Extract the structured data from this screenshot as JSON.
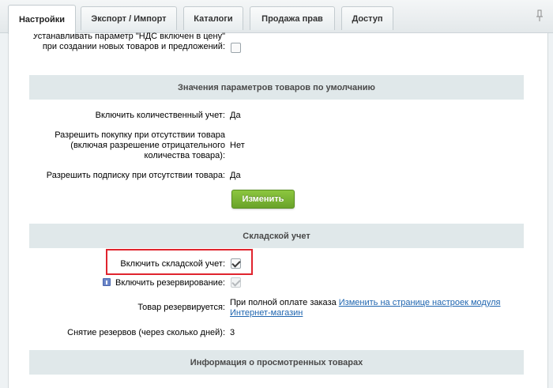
{
  "tabs": [
    {
      "label": "Настройки",
      "active": true
    },
    {
      "label": "Экспорт / Импорт"
    },
    {
      "label": "Каталоги"
    },
    {
      "label": "Продажа прав"
    },
    {
      "label": "Доступ"
    }
  ],
  "pin_icon": "pin-icon",
  "vat_setting": {
    "label": "Устанавливать параметр \"НДС включен в цену\" при создании новых товаров и предложений:",
    "checked": false
  },
  "defaults_section": {
    "title": "Значения параметров товаров по умолчанию",
    "rows": [
      {
        "label": "Включить количественный учет:",
        "value": "Да"
      },
      {
        "label": "Разрешить покупку при отсутствии товара (включая разрешение отрицательного количества товара):",
        "value": "Нет"
      },
      {
        "label": "Разрешить подписку при отсутствии товара:",
        "value": "Да"
      }
    ],
    "change_button": "Изменить"
  },
  "warehouse_section": {
    "title": "Складской учет",
    "enable_label": "Включить складской учет:",
    "enable_checked": true,
    "reservation_label": "Включить резервирование:",
    "reservation_checked": true,
    "reserved_label": "Товар резервируется:",
    "reserved_value": "При полной оплате заказа",
    "reserved_link": "Изменить на странице настроек модуля Интернет-магазин",
    "removal_label": "Снятие резервов (через сколько дней):",
    "removal_value": "3"
  },
  "viewed_section": {
    "title": "Информация о просмотренных товарах"
  },
  "colors": {
    "accent_green": "#7ab536",
    "highlight_red": "#e0242e",
    "section_bg": "#e0e8ea",
    "link": "#2066b0"
  }
}
